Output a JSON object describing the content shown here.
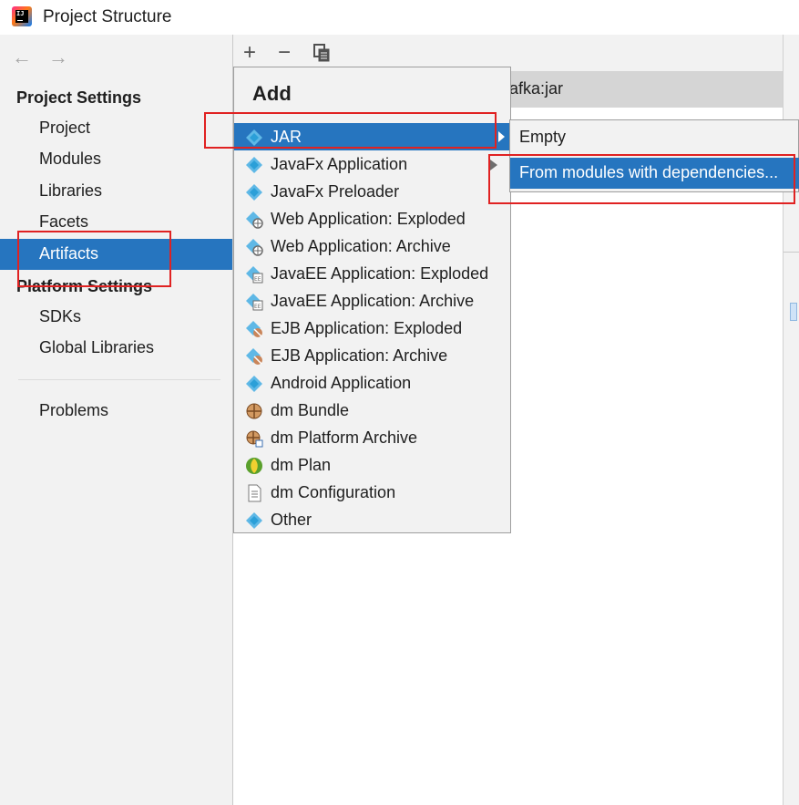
{
  "window": {
    "title": "Project Structure"
  },
  "nav": {
    "back": "←",
    "forward": "→"
  },
  "sidebar": {
    "project_settings_title": "Project Settings",
    "project_settings_items": [
      "Project",
      "Modules",
      "Libraries",
      "Facets",
      "Artifacts"
    ],
    "selected_item": "Artifacts",
    "platform_settings_title": "Platform Settings",
    "platform_settings_items": [
      "SDKs",
      "Global Libraries"
    ],
    "problems": "Problems"
  },
  "toolbar": {
    "add": "+",
    "remove": "−"
  },
  "artifact_row_label": "afka:jar",
  "add_popup": {
    "header": "Add",
    "items": [
      {
        "label": "JAR",
        "icon": "jar-icon"
      },
      {
        "label": "JavaFx Application",
        "icon": "javafx-icon"
      },
      {
        "label": "JavaFx Preloader",
        "icon": "javafx-icon"
      },
      {
        "label": "Web Application: Exploded",
        "icon": "web-app-icon"
      },
      {
        "label": "Web Application: Archive",
        "icon": "web-app-icon"
      },
      {
        "label": "JavaEE Application: Exploded",
        "icon": "javaee-icon"
      },
      {
        "label": "JavaEE Application: Archive",
        "icon": "javaee-icon"
      },
      {
        "label": "EJB Application: Exploded",
        "icon": "ejb-icon"
      },
      {
        "label": "EJB Application: Archive",
        "icon": "ejb-icon"
      },
      {
        "label": "Android Application",
        "icon": "android-icon"
      },
      {
        "label": "dm Bundle",
        "icon": "dm-bundle-icon"
      },
      {
        "label": "dm Platform Archive",
        "icon": "dm-platform-icon"
      },
      {
        "label": "dm Plan",
        "icon": "dm-plan-icon"
      },
      {
        "label": "dm Configuration",
        "icon": "document-icon"
      },
      {
        "label": "Other",
        "icon": "artifact-icon"
      }
    ]
  },
  "jar_submenu": {
    "items": [
      "Empty",
      "From modules with dependencies..."
    ],
    "highlighted": "From modules with dependencies..."
  },
  "colors": {
    "selection": "#2675bf",
    "annotation": "#e02222",
    "panel": "#f2f2f2"
  }
}
